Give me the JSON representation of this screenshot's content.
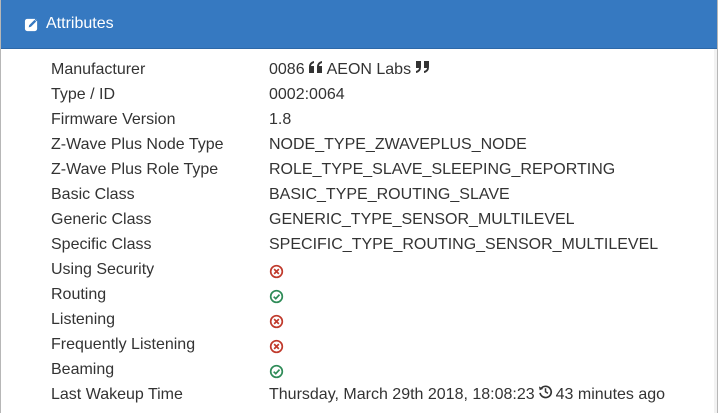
{
  "panel": {
    "title": "Attributes",
    "header_color": "#3679c1"
  },
  "attributes": {
    "manufacturer": {
      "label": "Manufacturer",
      "id": "0086",
      "name": "AEON Labs"
    },
    "type_id": {
      "label": "Type / ID",
      "value": "0002:0064"
    },
    "firmware": {
      "label": "Firmware Version",
      "value": "1.8"
    },
    "zwave_node_type": {
      "label": "Z-Wave Plus Node Type",
      "value": "NODE_TYPE_ZWAVEPLUS_NODE"
    },
    "zwave_role_type": {
      "label": "Z-Wave Plus Role Type",
      "value": "ROLE_TYPE_SLAVE_SLEEPING_REPORTING"
    },
    "basic_class": {
      "label": "Basic Class",
      "value": "BASIC_TYPE_ROUTING_SLAVE"
    },
    "generic_class": {
      "label": "Generic Class",
      "value": "GENERIC_TYPE_SENSOR_MULTILEVEL"
    },
    "specific_class": {
      "label": "Specific Class",
      "value": "SPECIFIC_TYPE_ROUTING_SENSOR_MULTILEVEL"
    },
    "using_security": {
      "label": "Using Security",
      "status": "no",
      "icon": "x-circle-icon"
    },
    "routing": {
      "label": "Routing",
      "status": "yes",
      "icon": "check-circle-icon"
    },
    "listening": {
      "label": "Listening",
      "status": "no",
      "icon": "x-circle-icon"
    },
    "frequently_listening": {
      "label": "Frequently Listening",
      "status": "no",
      "icon": "x-circle-icon"
    },
    "beaming": {
      "label": "Beaming",
      "status": "yes",
      "icon": "check-circle-icon"
    },
    "last_wakeup": {
      "label": "Last Wakeup Time",
      "value": "Thursday, March 29th 2018, 18:08:23",
      "relative": "43 minutes ago"
    }
  },
  "colors": {
    "status_yes": "#2e8b57",
    "status_no": "#c0392b"
  }
}
